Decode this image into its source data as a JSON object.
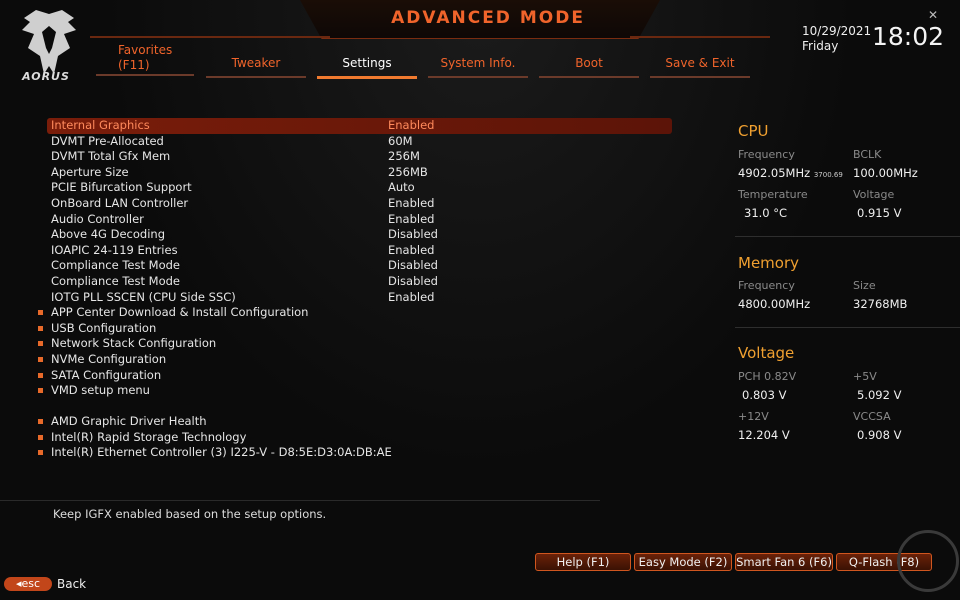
{
  "header": {
    "title": "ADVANCED MODE",
    "logo_text": "AORUS",
    "date": "10/29/2021",
    "day": "Friday",
    "time": "18:02",
    "close_glyph": "✕"
  },
  "tabs": [
    {
      "label": "Favorites",
      "label2": "(F11)"
    },
    {
      "label": "Tweaker"
    },
    {
      "label": "Settings",
      "active": true
    },
    {
      "label": "System Info."
    },
    {
      "label": "Boot"
    },
    {
      "label": "Save & Exit"
    }
  ],
  "settings": [
    {
      "label": "Internal Graphics",
      "value": "Enabled",
      "selected": true
    },
    {
      "label": "DVMT Pre-Allocated",
      "value": "60M"
    },
    {
      "label": "DVMT Total Gfx Mem",
      "value": "256M"
    },
    {
      "label": "Aperture Size",
      "value": "256MB"
    },
    {
      "label": "PCIE Bifurcation Support",
      "value": "Auto"
    },
    {
      "label": "OnBoard LAN Controller",
      "value": "Enabled"
    },
    {
      "label": "Audio Controller",
      "value": "Enabled"
    },
    {
      "label": "Above 4G Decoding",
      "value": "Disabled"
    },
    {
      "label": "IOAPIC 24-119 Entries",
      "value": "Enabled"
    },
    {
      "label": "Compliance Test Mode",
      "value": "Disabled"
    },
    {
      "label": "Compliance Test Mode",
      "value": "Disabled"
    },
    {
      "label": "IOTG PLL SSCEN (CPU Side SSC)",
      "value": "Enabled"
    }
  ],
  "submenus_a": [
    "APP Center Download & Install Configuration",
    "USB Configuration",
    "Network Stack Configuration",
    "NVMe Configuration",
    "SATA Configuration",
    "VMD setup menu"
  ],
  "submenus_b": [
    "AMD Graphic Driver Health",
    "Intel(R) Rapid Storage Technology",
    "Intel(R) Ethernet Controller (3) I225-V - D8:5E:D3:0A:DB:AE"
  ],
  "cpu": {
    "title": "CPU",
    "freq_label": "Frequency",
    "freq_value": "4902.05MHz",
    "freq_sub": "3700.69",
    "bclk_label": "BCLK",
    "bclk_value": "100.00MHz",
    "temp_label": "Temperature",
    "temp_value": "31.0 °C",
    "volt_label": "Voltage",
    "volt_value": "0.915 V"
  },
  "memory": {
    "title": "Memory",
    "freq_label": "Frequency",
    "freq_value": "4800.00MHz",
    "size_label": "Size",
    "size_value": "32768MB"
  },
  "voltage": {
    "title": "Voltage",
    "pch_label": "PCH 0.82V",
    "pch_value": "0.803 V",
    "v5_label": "+5V",
    "v5_value": "5.092 V",
    "v12_label": "+12V",
    "v12_value": "12.204 V",
    "vccsa_label": "VCCSA",
    "vccsa_value": "0.908 V"
  },
  "help_text": "Keep IGFX enabled based on the setup options.",
  "footer": {
    "help": "Help (F1)",
    "easy": "Easy Mode (F2)",
    "fan": "Smart Fan 6 (F6)",
    "qflash": "Q-Flash (F8)",
    "esc": "esc",
    "back": "Back"
  },
  "colors": {
    "accent": "#f0642b",
    "panel_title": "#f0a030",
    "selected_row": "#7a1d0a"
  }
}
